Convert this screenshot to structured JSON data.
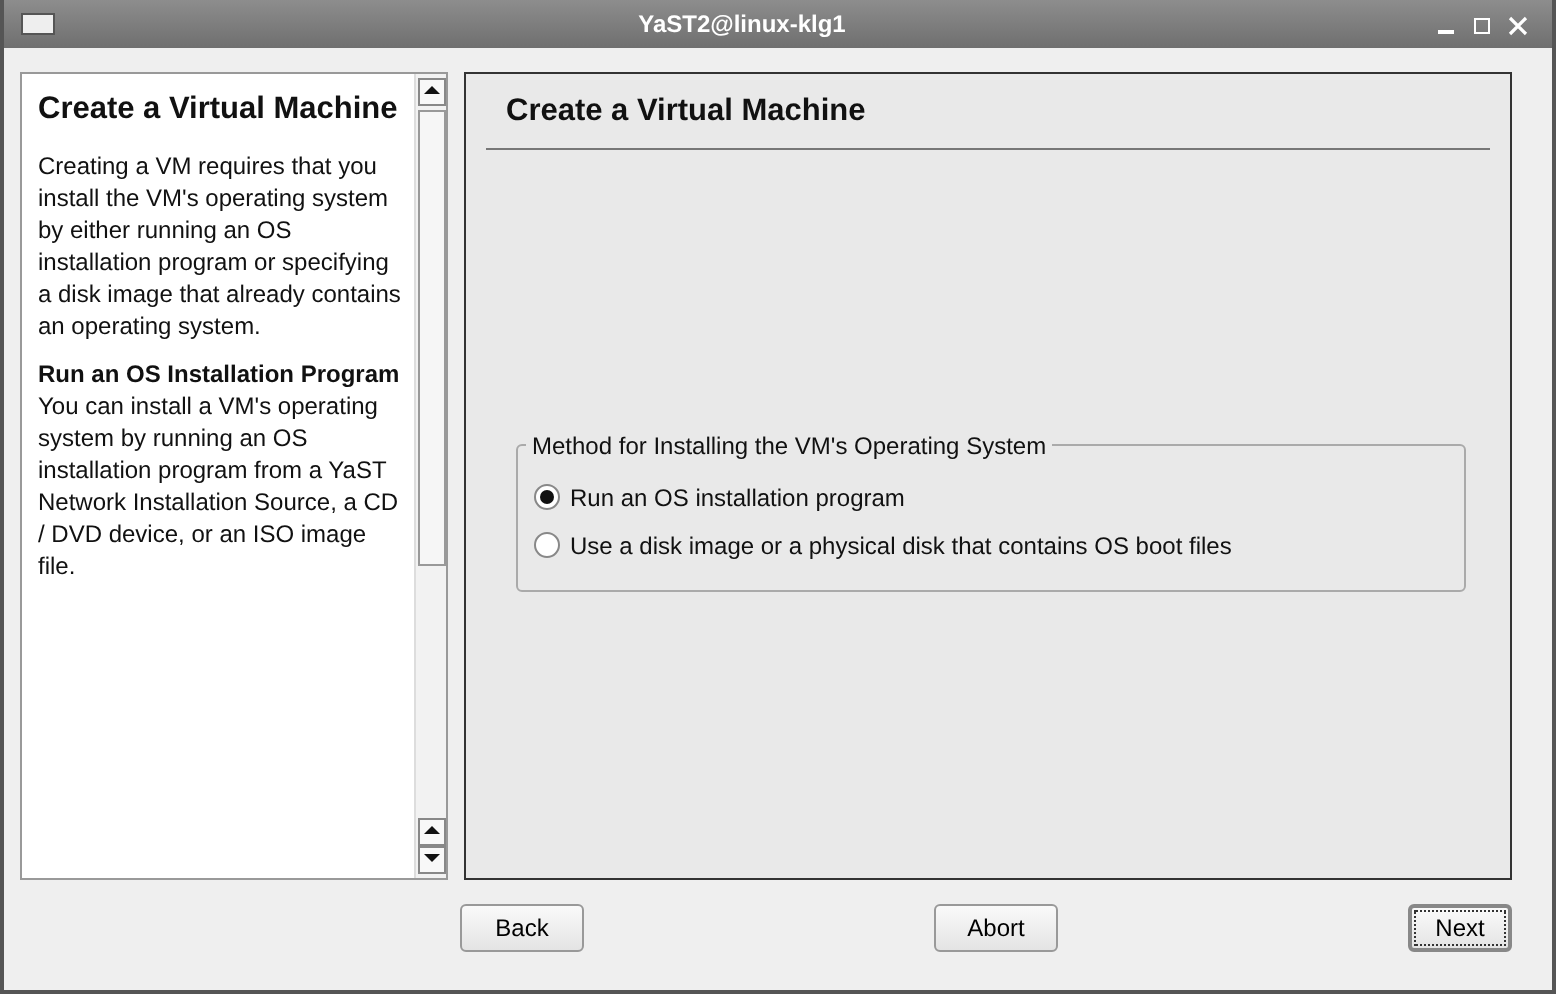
{
  "window": {
    "title": "YaST2@linux-klg1"
  },
  "help": {
    "title": "Create a Virtual Machine",
    "sections": [
      {
        "text": "Creating a VM requires that you install the VM's operating system by either running an OS installation program or specifying a disk image that already contains an operating system."
      },
      {
        "heading": "Run an OS Installation Program",
        "text": "You can install a VM's operating system by running an OS installation program from a YaST Network Installation Source, a CD / DVD device, or an ISO image file."
      }
    ]
  },
  "main": {
    "title": "Create a Virtual Machine",
    "group": {
      "label": "Method for Installing the VM's Operating System",
      "options": [
        {
          "label": "Run an OS installation program",
          "selected": true
        },
        {
          "label": "Use a disk image or a physical disk that contains OS boot files",
          "selected": false
        }
      ]
    }
  },
  "buttons": [
    {
      "label": "Back",
      "focused": false
    },
    {
      "label": "Abort",
      "focused": false
    },
    {
      "label": "Next",
      "focused": true
    }
  ]
}
